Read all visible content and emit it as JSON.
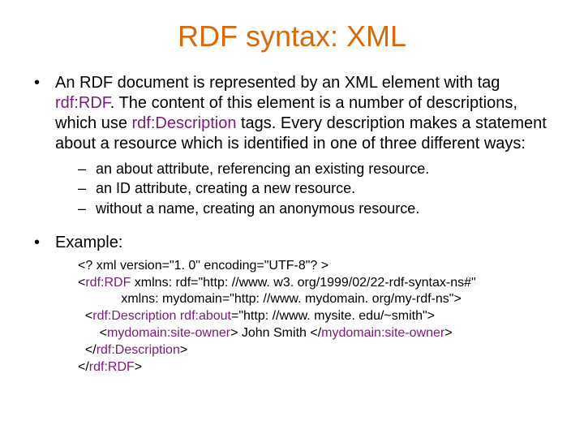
{
  "title": "RDF syntax: XML",
  "para1": {
    "pre1": "An RDF document is represented by an XML element with tag ",
    "kw1": "rdf:RDF",
    "mid1": ". The content of this element is a number of descriptions, which use ",
    "kw2": "rdf:Description",
    "post1": " tags. Every description makes a statement about a resource which is identified in one of three different ways:"
  },
  "ways": [
    "an about attribute, referencing an existing resource.",
    "an ID attribute, creating a new resource.",
    "without a name, creating an anonymous resource."
  ],
  "example_label": "Example:",
  "code": {
    "l1": "<? xml version=\"1. 0\" encoding=\"UTF-8\"? >",
    "l2": {
      "open": "<",
      "kw": "rdf:RDF",
      "rest": " xmlns: rdf=\"http: //www. w3. org/1999/02/22-rdf-syntax-ns#\""
    },
    "l3": "            xmlns: mydomain=\"http: //www. mydomain. org/my-rdf-ns\">",
    "l4": {
      "open": "  <",
      "kw": "rdf:Description",
      "mid": " ",
      "kw2": "rdf:about",
      "rest": "=\"http: //www. mysite. edu/~smith\">"
    },
    "l5": {
      "open": "      <",
      "kw": "mydomain:site-owner",
      "mid": "> John Smith </",
      "kw2": "mydomain:site-owner",
      "close": ">"
    },
    "l6": {
      "open": "  </",
      "kw": "rdf:Description",
      "close": ">"
    },
    "l7": {
      "open": "</",
      "kw": "rdf:RDF",
      "close": ">"
    }
  }
}
